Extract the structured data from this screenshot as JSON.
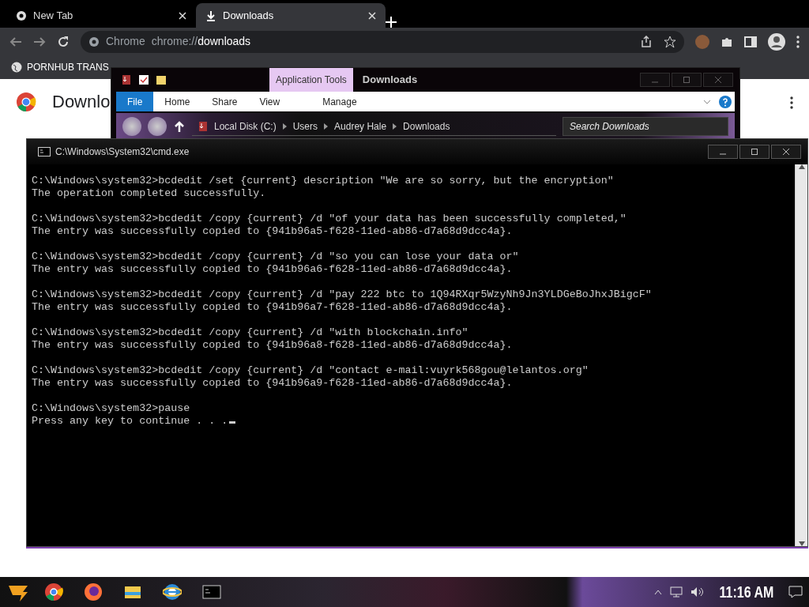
{
  "browser": {
    "tabs": [
      {
        "label": "New Tab",
        "selected": false
      },
      {
        "label": "Downloads",
        "selected": true
      }
    ],
    "address": {
      "site": "Chrome",
      "url_prefix": "chrome://",
      "url_path": "downloads"
    },
    "bookmarks": [
      {
        "label": "PORNHUB TRANS"
      }
    ],
    "page_title": "Downlo"
  },
  "explorer": {
    "context_tab": "Application Tools",
    "title": "Downloads",
    "ribbon_tabs": [
      {
        "label": "File",
        "selected": true
      },
      {
        "label": "Home",
        "selected": false
      },
      {
        "label": "Share",
        "selected": false
      },
      {
        "label": "View",
        "selected": false
      },
      {
        "label": "Manage",
        "selected": false
      }
    ],
    "breadcrumb": [
      "Local Disk (C:)",
      "Users",
      "Audrey Hale",
      "Downloads"
    ],
    "search": {
      "placeholder": "Search Downloads"
    }
  },
  "console": {
    "title": "C:\\Windows\\System32\\cmd.exe",
    "blocks": [
      [
        "C:\\Windows\\system32>bcdedit /set {current} description \"We are so sorry, but the encryption\"",
        "The operation completed successfully."
      ],
      [
        "C:\\Windows\\system32>bcdedit /copy {current} /d \"of your data has been successfully completed,\"",
        "The entry was successfully copied to {941b96a5-f628-11ed-ab86-d7a68d9dcc4a}."
      ],
      [
        "C:\\Windows\\system32>bcdedit /copy {current} /d \"so you can lose your data or\"",
        "The entry was successfully copied to {941b96a6-f628-11ed-ab86-d7a68d9dcc4a}."
      ],
      [
        "C:\\Windows\\system32>bcdedit /copy {current} /d \"pay 222 btc to 1Q94RXqr5WzyNh9Jn3YLDGeBoJhxJBigcF\"",
        "The entry was successfully copied to {941b96a7-f628-11ed-ab86-d7a68d9dcc4a}."
      ],
      [
        "C:\\Windows\\system32>bcdedit /copy {current} /d \"with blockchain.info\"",
        "The entry was successfully copied to {941b96a8-f628-11ed-ab86-d7a68d9dcc4a}."
      ],
      [
        "C:\\Windows\\system32>bcdedit /copy {current} /d \"contact e-mail:vuyrk568gou@lelantos.org\"",
        "The entry was successfully copied to {941b96a9-f628-11ed-ab86-d7a68d9dcc4a}."
      ],
      [
        "C:\\Windows\\system32>pause",
        "Press any key to continue . . ."
      ]
    ]
  },
  "taskbar": {
    "clock": "11:16 AM"
  }
}
